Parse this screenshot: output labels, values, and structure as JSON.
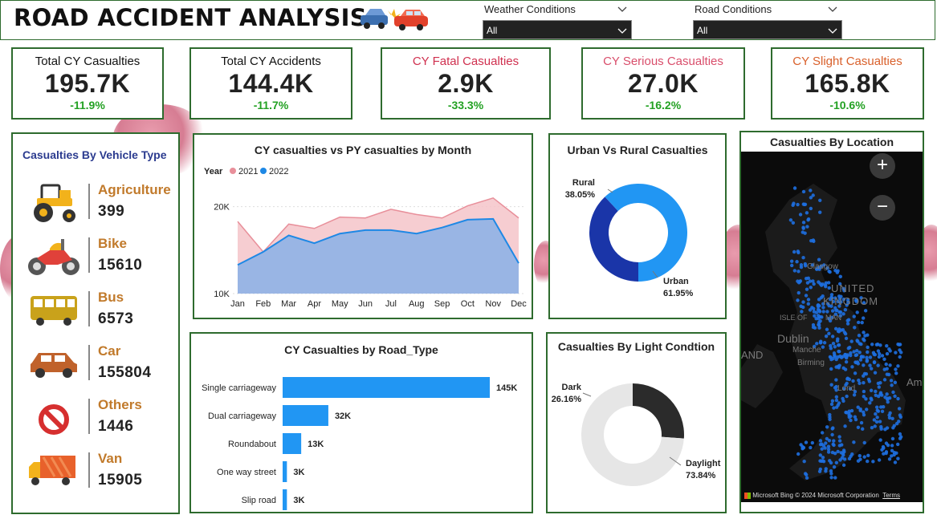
{
  "header": {
    "title": "ROAD ACCIDENT ANALYSIS",
    "weather_slicer": {
      "label": "Weather Conditions",
      "value": "All"
    },
    "road_slicer": {
      "label": "Road Conditions",
      "value": "All"
    }
  },
  "kpis": [
    {
      "title": "Total CY Casualties",
      "value": "195.7K",
      "change": "-11.9%",
      "title_color": "#111111"
    },
    {
      "title": "Total CY Accidents",
      "value": "144.4K",
      "change": "-11.7%",
      "title_color": "#111111"
    },
    {
      "title": "CY Fatal Casualties",
      "value": "2.9K",
      "change": "-33.3%",
      "title_color": "#d0304f"
    },
    {
      "title": "CY Serious Casualties",
      "value": "27.0K",
      "change": "-16.2%",
      "title_color": "#d94e6b"
    },
    {
      "title": "CY Slight Casualties",
      "value": "165.8K",
      "change": "-10.6%",
      "title_color": "#d9602b"
    }
  ],
  "vehicle_panel": {
    "title": "Casualties By Vehicle Type",
    "items": [
      {
        "label": "Agriculture",
        "value": "399",
        "icon": "tractor-icon"
      },
      {
        "label": "Bike",
        "value": "15610",
        "icon": "motorbike-icon"
      },
      {
        "label": "Bus",
        "value": "6573",
        "icon": "bus-icon"
      },
      {
        "label": "Car",
        "value": "155804",
        "icon": "car-icon"
      },
      {
        "label": "Others",
        "value": "1446",
        "icon": "prohibited-icon"
      },
      {
        "label": "Van",
        "value": "15905",
        "icon": "truck-icon"
      }
    ]
  },
  "chart_data": [
    {
      "type": "area",
      "title": "CY casualties vs PY casualties by Month",
      "legend_title": "Year",
      "legend_position": "top-left",
      "categories": [
        "Jan",
        "Feb",
        "Mar",
        "Apr",
        "May",
        "Jun",
        "Jul",
        "Aug",
        "Sep",
        "Oct",
        "Nov",
        "Dec"
      ],
      "series": [
        {
          "name": "2021",
          "color": "#e88f9a",
          "values": [
            18300,
            14800,
            18000,
            17500,
            18800,
            18700,
            19700,
            19100,
            18700,
            20100,
            21000,
            18700
          ]
        },
        {
          "name": "2022",
          "color": "#1e88e5",
          "values": [
            13300,
            14800,
            16700,
            15800,
            16900,
            17300,
            17300,
            16900,
            17600,
            18500,
            18600,
            13500
          ]
        }
      ],
      "yticks": [
        "10K",
        "20K"
      ],
      "ylim": [
        10000,
        22000
      ],
      "grid": true
    },
    {
      "type": "pie",
      "title": "Urban Vs Rural Casualties",
      "slices": [
        {
          "label": "Rural",
          "value": 38.05,
          "display": "38.05%",
          "color": "#1a35a8"
        },
        {
          "label": "Urban",
          "value": 61.95,
          "display": "61.95%",
          "color": "#2196f3"
        }
      ]
    },
    {
      "type": "bar",
      "title": "CY Casualties by Road_Type",
      "orientation": "horizontal",
      "categories": [
        "Single carriageway",
        "Dual carriageway",
        "Roundabout",
        "One way street",
        "Slip road"
      ],
      "values": [
        145000,
        32000,
        13000,
        3000,
        3000
      ],
      "data_labels": [
        "145K",
        "32K",
        "13K",
        "3K",
        "3K"
      ],
      "color": "#2196f3"
    },
    {
      "type": "pie",
      "title": "Casualties By Light Condtion",
      "slices": [
        {
          "label": "Dark",
          "value": 26.16,
          "display": "26.16%",
          "color": "#2b2b2b"
        },
        {
          "label": "Daylight",
          "value": 73.84,
          "display": "73.84%",
          "color": "#e6e6e6"
        }
      ]
    }
  ],
  "map": {
    "title": "Casualties By Location",
    "labels": {
      "glasgow": "Glasgow",
      "uk1": "UNITED",
      "uk2": "KINGDOM",
      "iom1": "ISLE OF",
      "iom2": "MAN",
      "dublin": "Dublin",
      "manchester": "Manche",
      "birmingham": "Birming",
      "london": "Lond",
      "and": "AND",
      "am": "Am"
    },
    "footer": {
      "brand": "Microsoft Bing",
      "copyright": "© 2024 Microsoft Corporation",
      "terms": "Terms"
    },
    "zoom_in": "+",
    "zoom_out": "−",
    "point_color": "#1e6fe0"
  }
}
